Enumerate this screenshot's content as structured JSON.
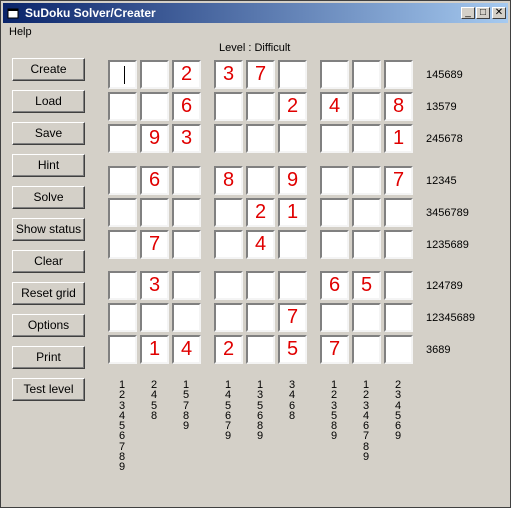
{
  "window": {
    "title": "SuDoku Solver/Creater",
    "minimize_glyph": "_",
    "maximize_glyph": "□",
    "close_glyph": "✕"
  },
  "menu": {
    "help": "Help"
  },
  "level": "Level : Difficult",
  "buttons": [
    "Create",
    "Load",
    "Save",
    "Hint",
    "Solve",
    "Show status",
    "Clear",
    "Reset grid",
    "Options",
    "Print",
    "Test level"
  ],
  "grid": [
    [
      "",
      "",
      "2",
      "3",
      "7",
      "",
      "",
      "",
      ""
    ],
    [
      "",
      "",
      "6",
      "",
      "",
      "2",
      "4",
      "",
      "8"
    ],
    [
      "",
      "9",
      "3",
      "",
      "",
      "",
      "",
      "",
      "1"
    ],
    [
      "",
      "6",
      "",
      "8",
      "",
      "9",
      "",
      "",
      "7"
    ],
    [
      "",
      "",
      "",
      "",
      "2",
      "1",
      "",
      "",
      ""
    ],
    [
      "",
      "7",
      "",
      "",
      "4",
      "",
      "",
      "",
      ""
    ],
    [
      "",
      "3",
      "",
      "",
      "",
      "",
      "6",
      "5",
      ""
    ],
    [
      "",
      "",
      "",
      "",
      "",
      "7",
      "",
      "",
      ""
    ],
    [
      "",
      "1",
      "4",
      "2",
      "",
      "5",
      "7",
      "",
      ""
    ]
  ],
  "selected_cell": {
    "row": 1,
    "col": 1
  },
  "row_candidates": [
    "145689",
    "13579",
    "245678",
    "12345",
    "3456789",
    "1235689",
    "124789",
    "12345689",
    "3689"
  ],
  "col_candidates": [
    "123456789",
    "2458",
    "15789",
    "145679",
    "135689",
    "3468",
    "123589",
    "12346789",
    "234569"
  ],
  "colors": {
    "given_digit": "#e00000",
    "title_start": "#0a246a",
    "title_end": "#a6caf0",
    "face": "#d4d0c8"
  }
}
